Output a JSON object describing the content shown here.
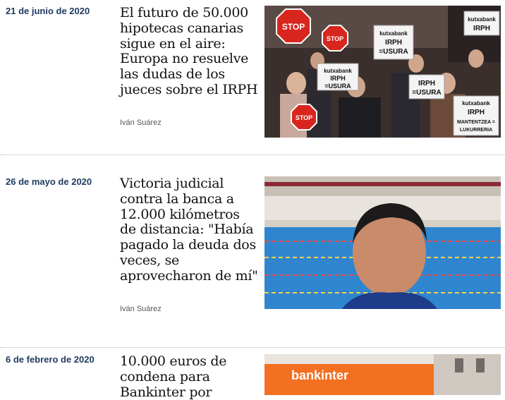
{
  "articles": [
    {
      "date": "21 de junio de 2020",
      "headline": "El futuro de 50.000 hipotecas canarias sigue en el aire: Europa no resuelve las dudas de los jueces sobre el IRPH",
      "author": "Iván Suárez",
      "image_signs": {
        "stop_top": "STOP",
        "stop_mid": "STOP",
        "stop_low": "STOP",
        "sign1": [
          "kutxabank",
          "IRPH",
          "=USURA"
        ],
        "sign2": [
          "kutxabank",
          "IRPH",
          "=USURA"
        ],
        "sign3": [
          "kutxabank",
          "IRPH",
          "MANTENTZEA =",
          "LUKURRERIA"
        ],
        "sign4": [
          "IRPH",
          "=USURA"
        ],
        "sign5": [
          "kutxabank",
          "IRPH"
        ]
      }
    },
    {
      "date": "26 de mayo de 2020",
      "headline": "Victoria judicial contra la banca a 12.000 kilómetros de distancia: \"Había pagado la deuda dos veces, se aprovecharon de mí\"",
      "author": "Iván Suárez"
    },
    {
      "date": "6 de febrero de 2020",
      "headline": "10.000 euros de condena para Bankinter por",
      "image_text": "bankinter"
    }
  ],
  "colors": {
    "date": "#1d3a5f",
    "headline": "#111111",
    "author": "#555555",
    "bankinter_orange": "#f36f21"
  }
}
